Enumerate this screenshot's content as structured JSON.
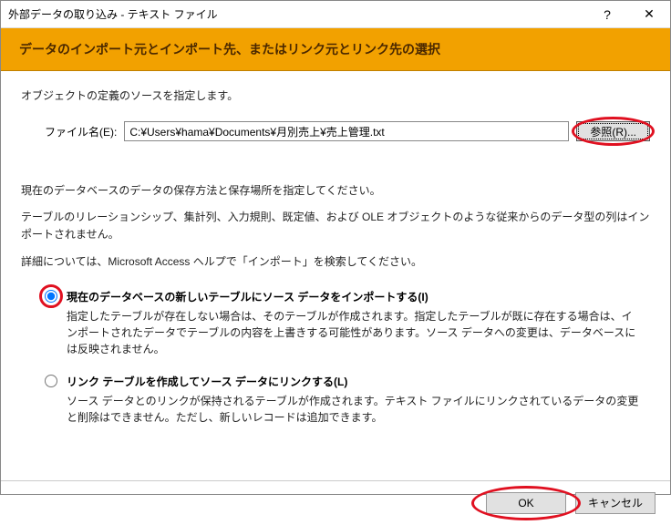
{
  "titlebar": {
    "title": "外部データの取り込み - テキスト ファイル",
    "help": "?",
    "close": "✕"
  },
  "banner": {
    "heading": "データのインポート元とインポート先、またはリンク元とリンク先の選択"
  },
  "content": {
    "instr1": "オブジェクトの定義のソースを指定します。",
    "file_label": "ファイル名(E):",
    "file_value": "C:¥Users¥hama¥Documents¥月別売上¥売上管理.txt",
    "browse_label": "参照(R)...",
    "instr2": "現在のデータベースのデータの保存方法と保存場所を指定してください。",
    "instr3": "テーブルのリレーションシップ、集計列、入力規則、既定値、および OLE オブジェクトのような従来からのデータ型の列はインポートされません。",
    "instr4": "詳細については、Microsoft Access ヘルプで「インポート」を検索してください。"
  },
  "options": {
    "opt1": {
      "label": "現在のデータベースの新しいテーブルにソース データをインポートする(I)",
      "desc": "指定したテーブルが存在しない場合は、そのテーブルが作成されます。指定したテーブルが既に存在する場合は、インポートされたデータでテーブルの内容を上書きする可能性があります。ソース データへの変更は、データベースには反映されません。"
    },
    "opt2": {
      "label": "リンク テーブルを作成してソース データにリンクする(L)",
      "desc": "ソース データとのリンクが保持されるテーブルが作成されます。テキスト ファイルにリンクされているデータの変更と削除はできません。ただし、新しいレコードは追加できます。"
    }
  },
  "buttons": {
    "ok": "OK",
    "cancel": "キャンセル"
  }
}
